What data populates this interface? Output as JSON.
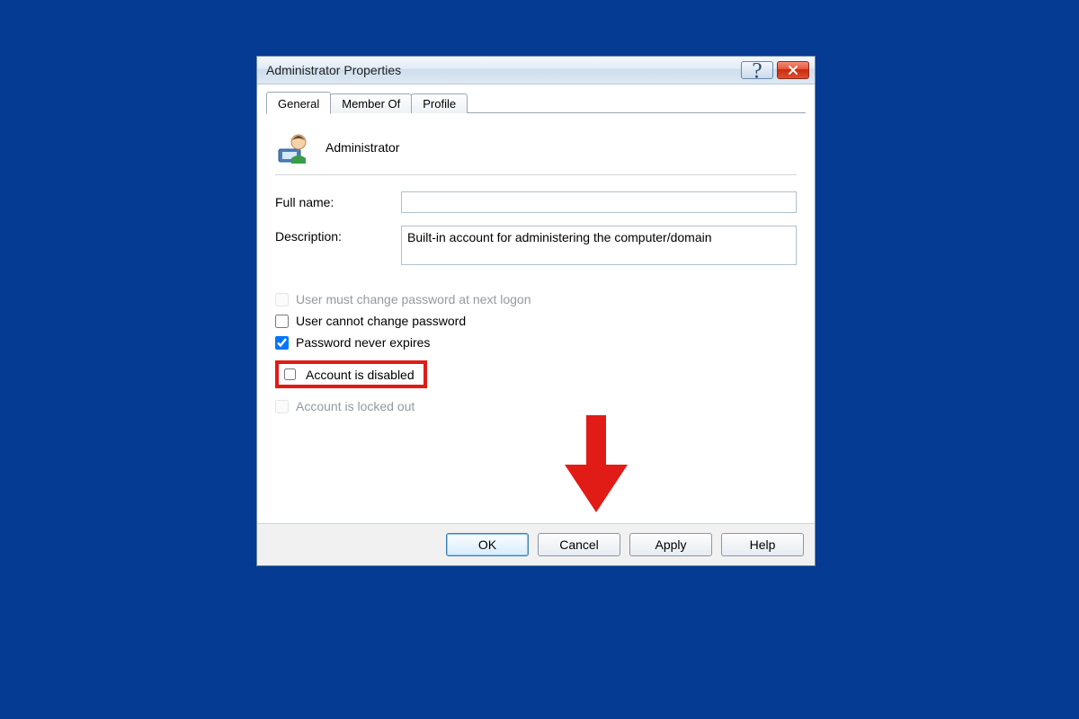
{
  "window": {
    "title": "Administrator Properties"
  },
  "tabs": [
    {
      "label": "General"
    },
    {
      "label": "Member Of"
    },
    {
      "label": "Profile"
    }
  ],
  "account": {
    "name": "Administrator"
  },
  "fields": {
    "full_name": {
      "label": "Full name:",
      "value": ""
    },
    "description": {
      "label": "Description:",
      "value": "Built-in account for administering the computer/domain"
    }
  },
  "options": {
    "must_change": {
      "label": "User must change password at next logon",
      "checked": false,
      "enabled": false
    },
    "cannot_change": {
      "label": "User cannot change password",
      "checked": false,
      "enabled": true
    },
    "never_expires": {
      "label": "Password never expires",
      "checked": true,
      "enabled": true
    },
    "disabled": {
      "label": "Account is disabled",
      "checked": false,
      "enabled": true
    },
    "locked_out": {
      "label": "Account is locked out",
      "checked": false,
      "enabled": false
    }
  },
  "buttons": {
    "ok": "OK",
    "cancel": "Cancel",
    "apply": "Apply",
    "help": "Help"
  },
  "annotations": {
    "highlight_option": "disabled",
    "arrow_points_to_button": "apply",
    "highlight_color": "#e11b16"
  }
}
